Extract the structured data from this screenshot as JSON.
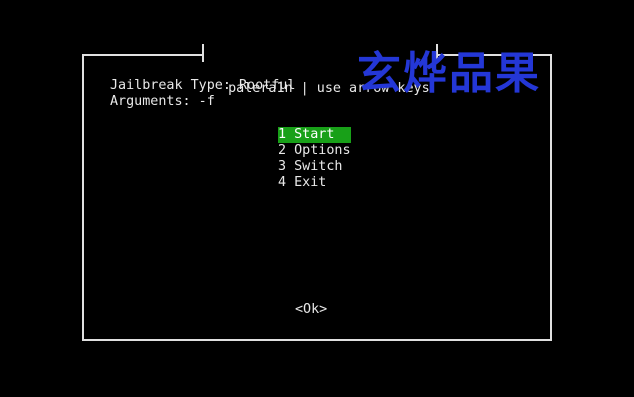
{
  "window": {
    "title": "palera1n | use arrow keys"
  },
  "info": {
    "jailbreak_type": "Jailbreak Type: Rootful",
    "arguments": "Arguments: -f"
  },
  "menu": {
    "items": [
      {
        "label": "1 Start",
        "selected": true
      },
      {
        "label": "2 Options",
        "selected": false
      },
      {
        "label": "3 Switch",
        "selected": false
      },
      {
        "label": "4 Exit",
        "selected": false
      }
    ]
  },
  "ok_button": {
    "label": "<Ok>"
  },
  "watermark": {
    "text": "玄烨品果"
  },
  "colors": {
    "background": "#000000",
    "selection": "#18a018",
    "watermark": "#2437d6"
  }
}
